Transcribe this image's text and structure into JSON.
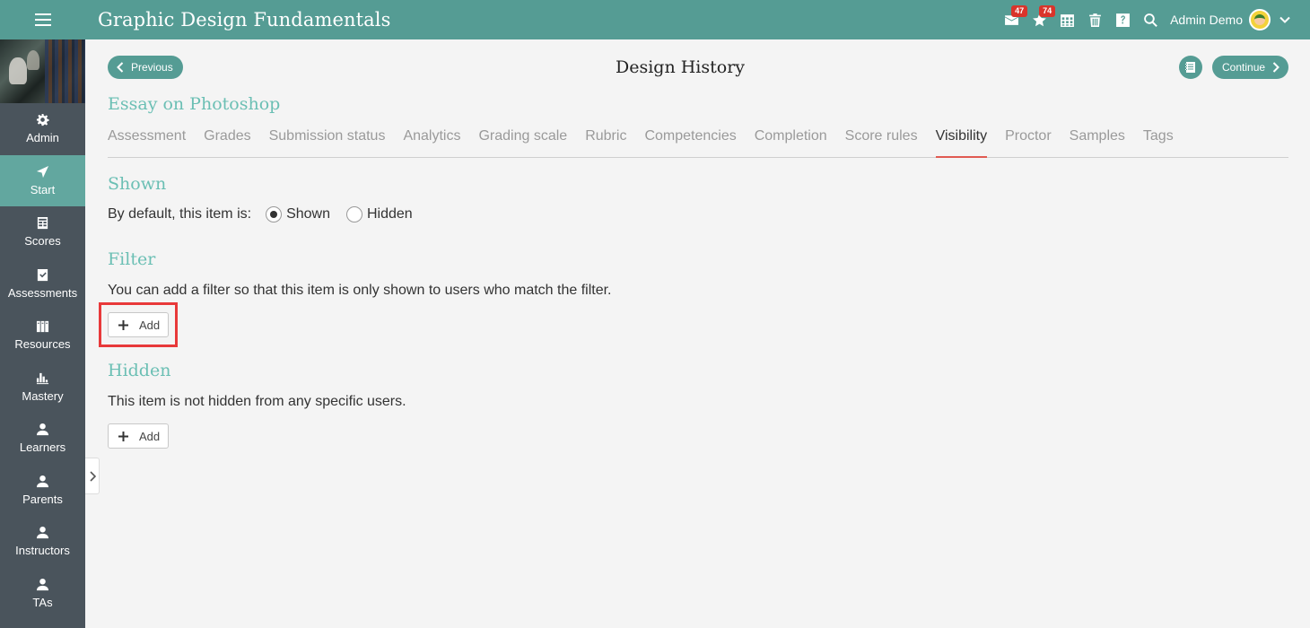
{
  "app": {
    "title": "Graphic Design Fundamentals"
  },
  "topbar": {
    "mail_badge": "47",
    "notifications_badge": "74",
    "user_name": "Admin Demo"
  },
  "sidebar": {
    "items": [
      {
        "label": "Admin",
        "icon": "gear-icon"
      },
      {
        "label": "Start",
        "icon": "navigation-arrow-icon"
      },
      {
        "label": "Scores",
        "icon": "gradebook-icon"
      },
      {
        "label": "Assessments",
        "icon": "checklist-icon"
      },
      {
        "label": "Resources",
        "icon": "books-icon"
      },
      {
        "label": "Mastery",
        "icon": "bar-chart-icon"
      },
      {
        "label": "Learners",
        "icon": "person-icon"
      },
      {
        "label": "Parents",
        "icon": "person-icon"
      },
      {
        "label": "Instructors",
        "icon": "person-icon"
      },
      {
        "label": "TAs",
        "icon": "person-icon"
      }
    ],
    "active": "Start"
  },
  "header": {
    "previous_label": "Previous",
    "continue_label": "Continue",
    "page_title": "Design History"
  },
  "item_title": "Essay on Photoshop",
  "tabs": [
    "Assessment",
    "Grades",
    "Submission status",
    "Analytics",
    "Grading scale",
    "Rubric",
    "Competencies",
    "Completion",
    "Score rules",
    "Visibility",
    "Proctor",
    "Samples",
    "Tags"
  ],
  "active_tab": "Visibility",
  "shown": {
    "heading": "Shown",
    "default_label": "By default, this item is:",
    "options": [
      "Shown",
      "Hidden"
    ],
    "selected": "Shown"
  },
  "filter": {
    "heading": "Filter",
    "description": "You can add a filter so that this item is only shown to users who match the filter.",
    "add_label": "Add"
  },
  "hidden": {
    "heading": "Hidden",
    "description": "This item is not hidden from any specific users.",
    "add_label": "Add"
  },
  "colors": {
    "topbar": "#559c94",
    "sidebar": "#4a545c",
    "sidebar_active": "#62a79f",
    "accent_heading": "#6bbfb4",
    "active_tab_underline": "#e05a52",
    "badge": "#d9342b",
    "highlight": "#e8393a"
  }
}
